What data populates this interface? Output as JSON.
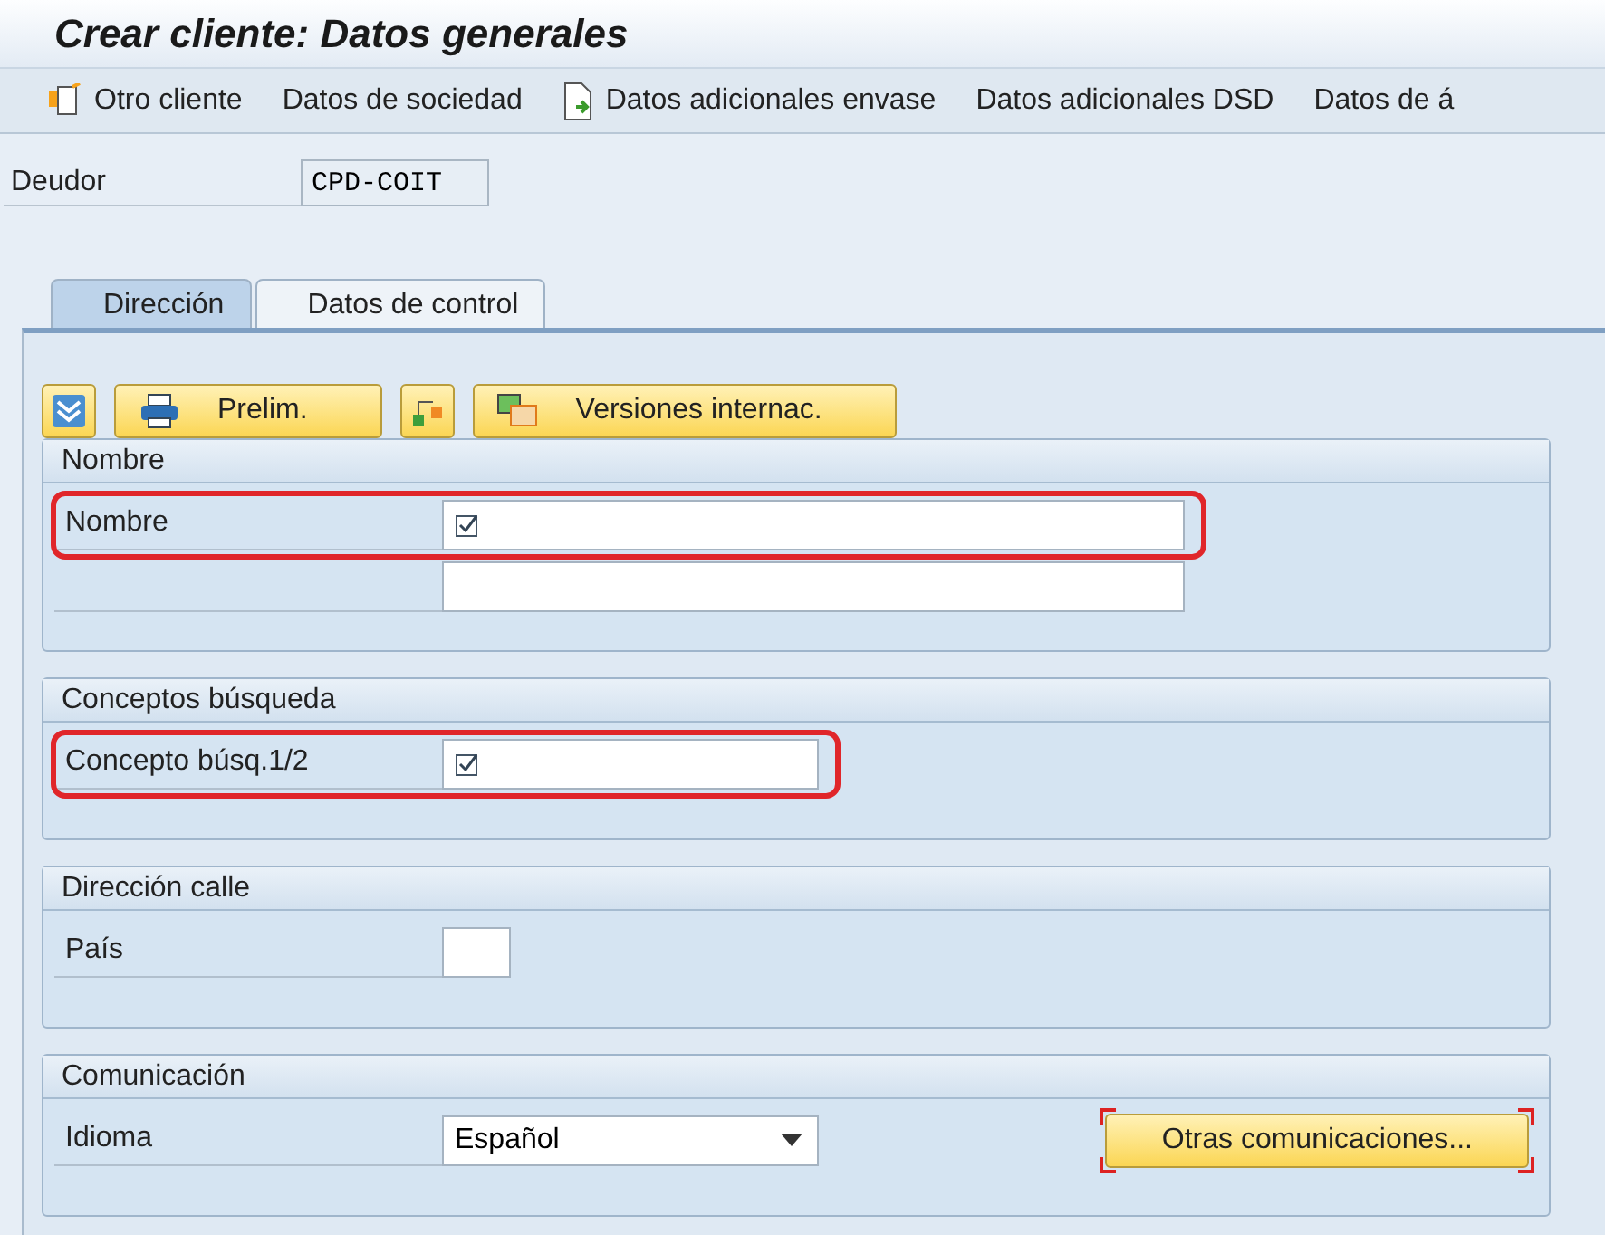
{
  "window": {
    "title": "Crear cliente: Datos generales"
  },
  "toolbar": [
    {
      "label": "Otro cliente"
    },
    {
      "label": "Datos de sociedad"
    },
    {
      "label": "Datos adicionales envase"
    },
    {
      "label": "Datos adicionales DSD"
    },
    {
      "label": "Datos de á"
    }
  ],
  "header_field": {
    "label": "Deudor",
    "value": "CPD-COIT"
  },
  "tabs": [
    {
      "label": "Dirección",
      "selected": true
    },
    {
      "label": "Datos de control",
      "selected": false
    }
  ],
  "buttons": [
    {
      "kind": "icon"
    },
    {
      "kind": "labeled",
      "label": "Prelim."
    },
    {
      "kind": "icon"
    },
    {
      "kind": "labeled",
      "label": "Versiones internac."
    }
  ],
  "groups": [
    {
      "title": "Nombre",
      "fields": [
        {
          "kind": "text",
          "label": "Nombre",
          "required": true,
          "highlighted": true
        },
        {
          "kind": "text",
          "required": false,
          "highlighted": false
        }
      ]
    },
    {
      "title": "Conceptos búsqueda",
      "fields": [
        {
          "kind": "text",
          "label": "Concepto búsq.1/2",
          "required": true,
          "highlighted": true
        }
      ]
    },
    {
      "title": "Dirección calle",
      "fields": [
        {
          "kind": "text",
          "label": "País",
          "required": false,
          "highlighted": false
        }
      ]
    },
    {
      "title": "Comunicación",
      "fields": [
        {
          "kind": "dropdown",
          "label": "Idioma",
          "value": "Español",
          "required": false,
          "highlighted": false,
          "button": {
            "label": "Otras comunicaciones...",
            "focused": true
          }
        }
      ]
    }
  ]
}
